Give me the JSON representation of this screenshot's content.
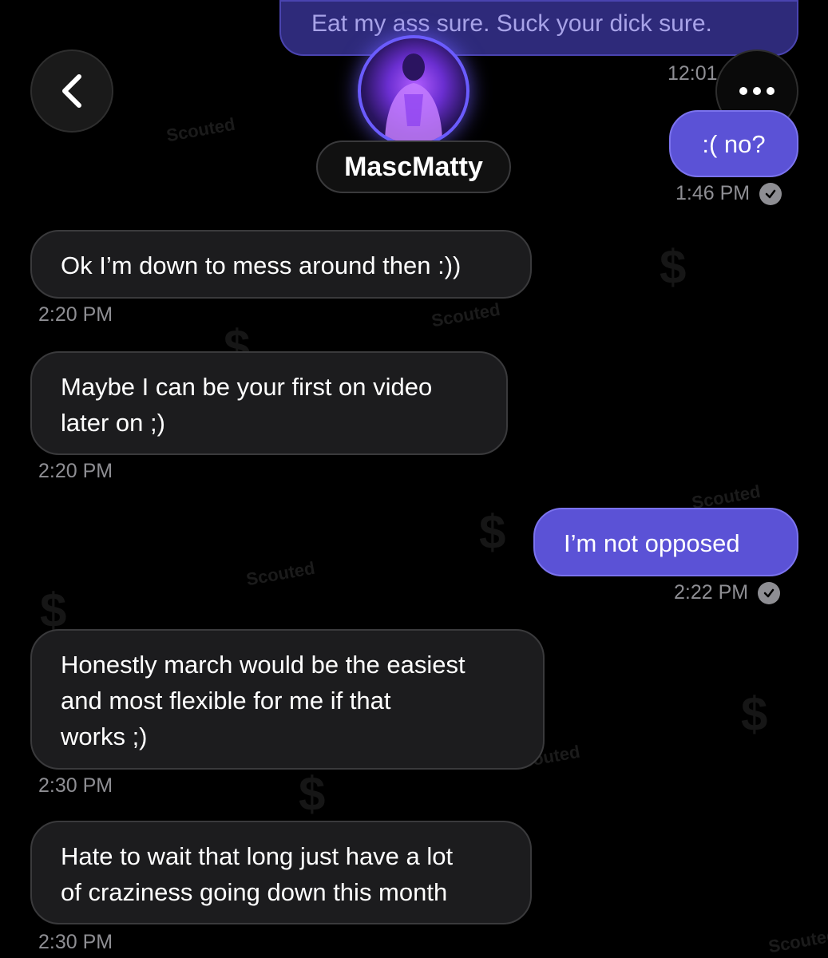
{
  "header": {
    "contact_name": "MascMatty"
  },
  "watermark": {
    "text": "Scouted"
  },
  "messages": [
    {
      "direction": "out",
      "text": "Eat my ass sure. Suck your dick sure.",
      "time": "12:01"
    },
    {
      "direction": "out",
      "text": ":( no?",
      "time": "1:46 PM"
    },
    {
      "direction": "in",
      "text": "Ok I’m down to mess around then :))",
      "time": "2:20 PM"
    },
    {
      "direction": "in",
      "lines": [
        "Maybe I can be your first on video",
        "later on ;)"
      ],
      "time": "2:20 PM"
    },
    {
      "direction": "out",
      "text": "I’m not opposed",
      "time": "2:22 PM"
    },
    {
      "direction": "in",
      "lines": [
        "Honestly march would be the easiest",
        "and most flexible for me if that",
        "works ;)"
      ],
      "time": "2:30 PM"
    },
    {
      "direction": "in",
      "lines": [
        "Hate to wait that long just have a lot",
        "of craziness going down this month"
      ],
      "time": "2:30 PM"
    }
  ],
  "icons": {
    "back": "chevron-left-icon",
    "more": "more-horizontal-icon",
    "read": "read-check-icon"
  },
  "colors": {
    "background": "#000000",
    "outgoing_bubble": "#5b52d6",
    "incoming_bubble": "#1c1c1e",
    "timestamp": "#8e8e93",
    "avatar_ring": "#6b5cff"
  }
}
